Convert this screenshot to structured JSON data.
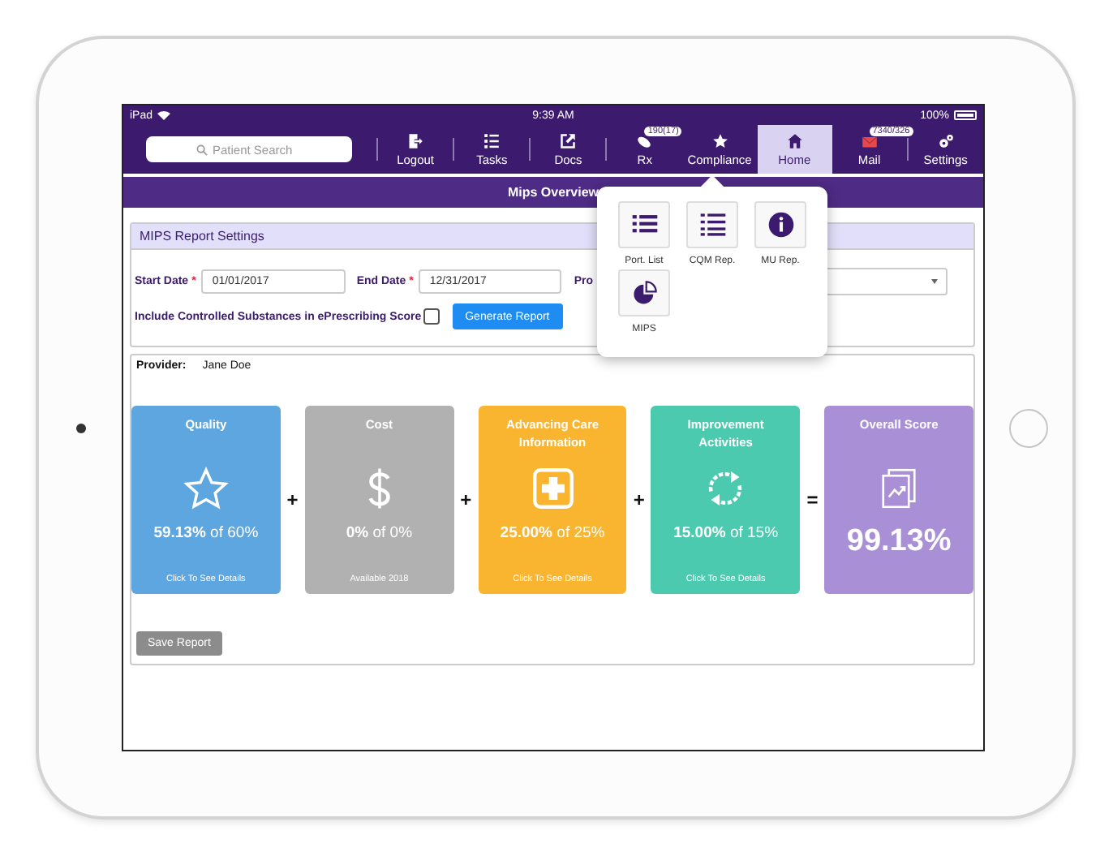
{
  "status_bar": {
    "device": "iPad",
    "time": "9:39 AM",
    "battery": "100%"
  },
  "nav": {
    "search": {
      "placeholder": "Patient Search"
    },
    "items": [
      {
        "label": "Logout",
        "selected": false
      },
      {
        "label": "Tasks",
        "selected": false
      },
      {
        "label": "Docs",
        "selected": false
      },
      {
        "label": "Rx",
        "badge": "190(17)",
        "selected": false
      },
      {
        "label": "Compliance",
        "selected": false
      },
      {
        "label": "Home",
        "selected": true
      },
      {
        "label": "Mail",
        "badge": "7340/326",
        "selected": false
      },
      {
        "label": "Settings",
        "selected": false
      }
    ]
  },
  "page_title": "Mips Overview",
  "settings_panel": {
    "title": "MIPS Report Settings",
    "start_date": {
      "label": "Start Date",
      "required_mark": "*",
      "value": "01/01/2017"
    },
    "end_date": {
      "label": "End Date",
      "required_mark": "*",
      "value": "12/31/2017"
    },
    "provider_label": "Pro",
    "controlled_substances": {
      "label": "Include Controlled Substances in ePrescribing Score",
      "checked": false
    },
    "generate_button": "Generate Report"
  },
  "report": {
    "provider_label": "Provider:",
    "provider": "Jane Doe",
    "cards": [
      {
        "kind": "metric",
        "title": "Quality",
        "score": "**59.13%** of 60%",
        "note": "Click To See Details",
        "color": "#5ea6e0",
        "operator": "+"
      },
      {
        "kind": "metric",
        "title": "Cost",
        "score": "**0%** of 0%",
        "note": "Available 2018",
        "color": "#b1b1b1",
        "operator": "+"
      },
      {
        "kind": "metric",
        "title": "Advancing Care Information",
        "score": "**25.00%** of 25%",
        "note": "Click To See Details",
        "color": "#f9b52f",
        "operator": "+"
      },
      {
        "kind": "metric",
        "title": "Improvement Activities",
        "score": "**15.00%** of 15%",
        "note": "Click To See Details",
        "color": "#4ccab0",
        "operator": "="
      },
      {
        "kind": "total",
        "title": "Overall Score",
        "score": "99.13%",
        "color": "#a98fd5"
      }
    ],
    "save_button": "Save Report"
  },
  "compliance_menu": {
    "items": [
      {
        "label": "Port. List"
      },
      {
        "label": "CQM Rep."
      },
      {
        "label": "MU Rep."
      },
      {
        "label": "MIPS"
      }
    ]
  }
}
